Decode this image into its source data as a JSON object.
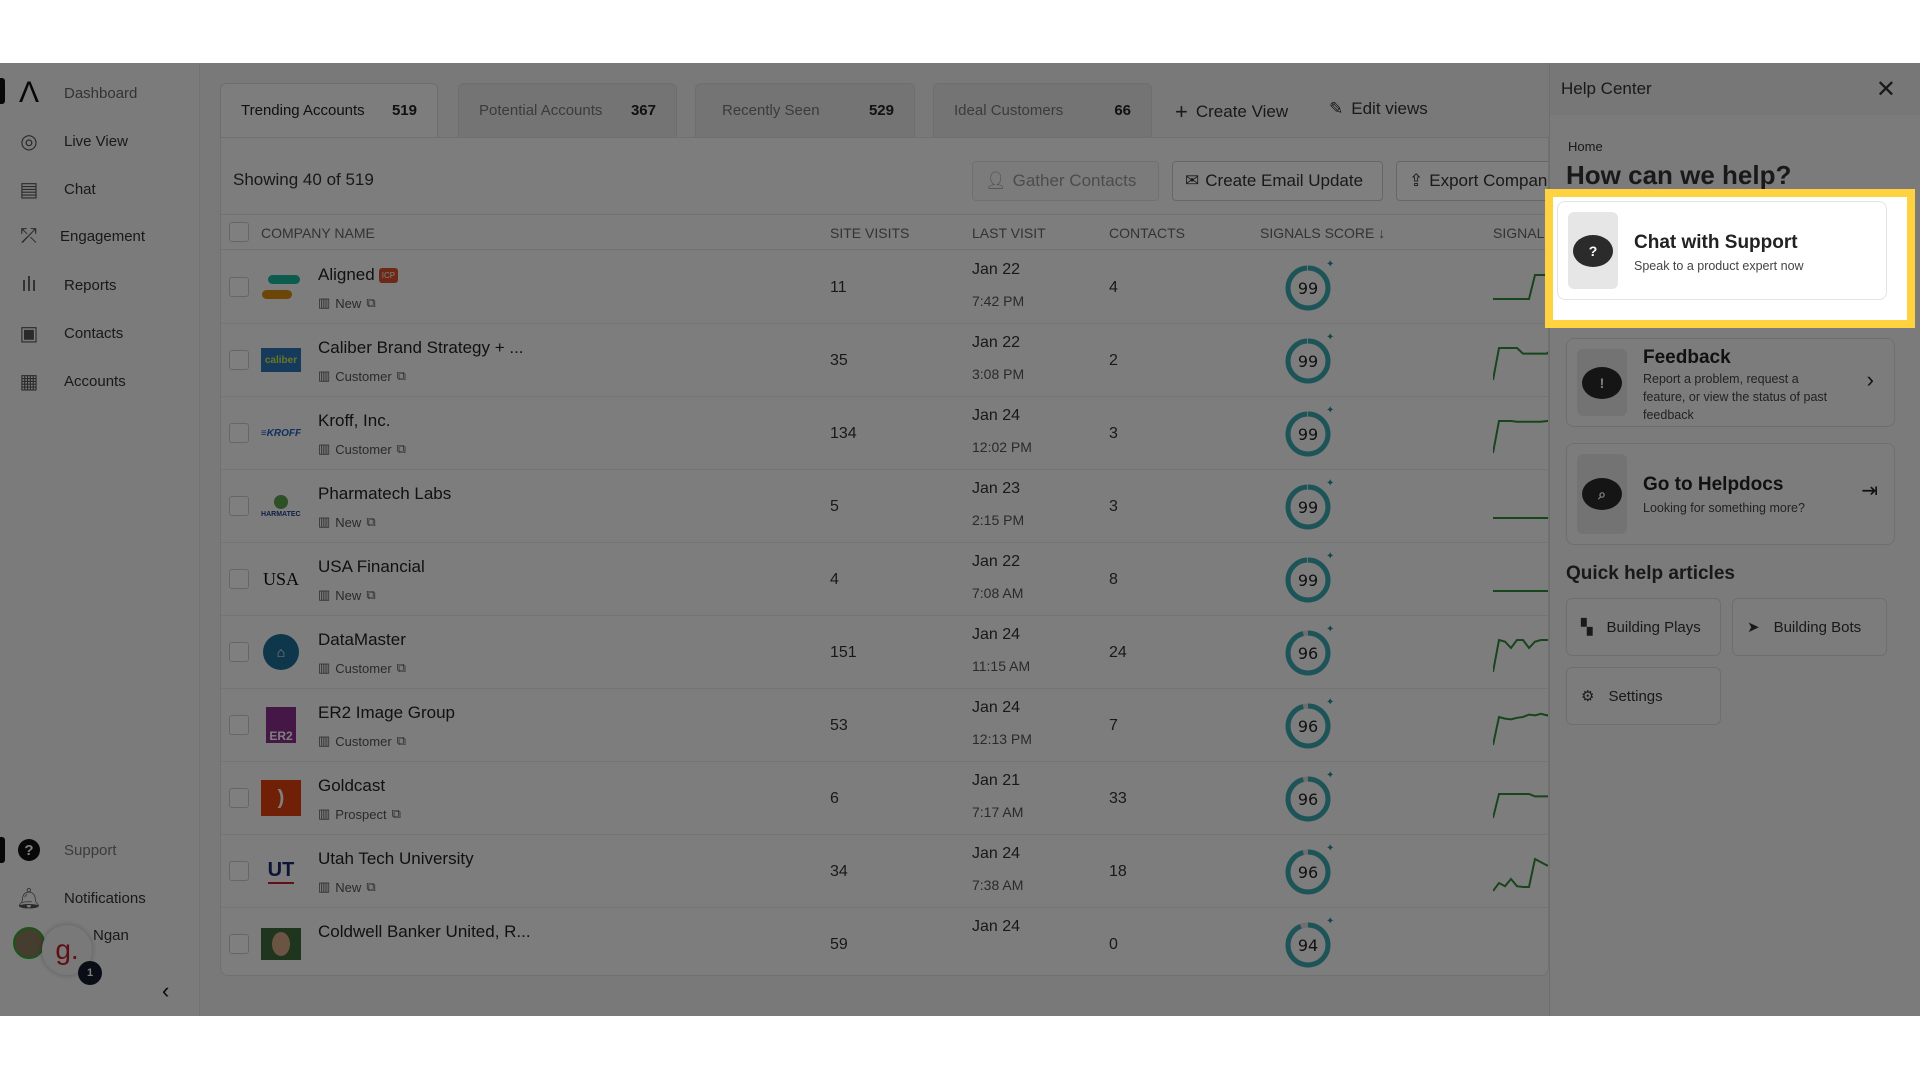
{
  "sidebar": {
    "items": [
      {
        "label": "Dashboard",
        "icon": "logo-icon"
      },
      {
        "label": "Live View",
        "icon": "globe-search-icon"
      },
      {
        "label": "Chat",
        "icon": "chat-icon"
      },
      {
        "label": "Engagement",
        "icon": "strategy-icon"
      },
      {
        "label": "Reports",
        "icon": "bar-chart-icon"
      },
      {
        "label": "Contacts",
        "icon": "contact-card-icon"
      },
      {
        "label": "Accounts",
        "icon": "building-icon"
      }
    ],
    "support": "Support",
    "notifications": "Notifications",
    "user": {
      "name": "Ngan",
      "badge": "1",
      "avatar_letter": "g."
    }
  },
  "tabs": [
    {
      "label": "Trending Accounts",
      "count": "519"
    },
    {
      "label": "Potential Accounts",
      "count": "367"
    },
    {
      "label": "Recently Seen",
      "count": "529"
    },
    {
      "label": "Ideal Customers",
      "count": "66"
    }
  ],
  "tab_actions": {
    "create_view": "Create View",
    "edit_views": "Edit views"
  },
  "toolbar": {
    "showing": "Showing 40 of  519",
    "gather": "Gather Contacts",
    "email": "Create Email Update",
    "export": "Export Compan"
  },
  "columns": [
    "COMPANY NAME",
    "SITE VISITS",
    "LAST VISIT",
    "CONTACTS",
    "SIGNALS SCORE ↓",
    "SIGNALS"
  ],
  "rows": [
    {
      "name": "Aligned",
      "icp": "ICP",
      "status": "New",
      "visits": "11",
      "date": "Jan 22",
      "time": "7:42 PM",
      "contacts": "4",
      "score": 99,
      "logo": "aligned",
      "trend": [
        1,
        1,
        1,
        1,
        1,
        1,
        1,
        4,
        4,
        4,
        4
      ]
    },
    {
      "name": "Caliber Brand Strategy + ...",
      "status": "Customer",
      "visits": "35",
      "date": "Jan 22",
      "time": "3:08 PM",
      "contacts": "2",
      "score": 99,
      "logo": "caliber",
      "trend": [
        0,
        4,
        4,
        4,
        4,
        3.3,
        3.3,
        3.3,
        3.3,
        3.3,
        4
      ]
    },
    {
      "name": "Kroff, Inc.",
      "status": "Customer",
      "visits": "134",
      "date": "Jan 24",
      "time": "12:02 PM",
      "contacts": "3",
      "score": 99,
      "logo": "kroff",
      "trend": [
        0,
        4,
        4,
        4,
        3.9,
        3.9,
        3.9,
        3.9,
        3.9,
        4,
        4
      ]
    },
    {
      "name": "Pharmatech Labs",
      "status": "New",
      "visits": "5",
      "date": "Jan 23",
      "time": "2:15 PM",
      "contacts": "3",
      "score": 99,
      "logo": "pharmatech",
      "trend": [
        1,
        1,
        1,
        1,
        1,
        1,
        1,
        1,
        1,
        1,
        1
      ]
    },
    {
      "name": "USA Financial",
      "status": "New",
      "visits": "4",
      "date": "Jan 22",
      "time": "7:08 AM",
      "contacts": "8",
      "score": 99,
      "logo": "usa",
      "trend": [
        1,
        1,
        1,
        1,
        1,
        1,
        1,
        1,
        1,
        1,
        1
      ]
    },
    {
      "name": "DataMaster",
      "status": "Customer",
      "visits": "151",
      "date": "Jan 24",
      "time": "11:15 AM",
      "contacts": "24",
      "score": 96,
      "logo": "datamaster",
      "trend": [
        0,
        4,
        3.8,
        3,
        4,
        4,
        3,
        3.8,
        4,
        4,
        4
      ]
    },
    {
      "name": "ER2 Image Group",
      "status": "Customer",
      "visits": "53",
      "date": "Jan 24",
      "time": "12:13 PM",
      "contacts": "7",
      "score": 96,
      "logo": "er2",
      "trend": [
        0,
        3.5,
        3.3,
        3.2,
        3.4,
        3.5,
        3.8,
        3.7,
        3.9,
        3.7,
        4
      ]
    },
    {
      "name": "Goldcast",
      "status": "Prospect",
      "visits": "6",
      "date": "Jan 21",
      "time": "7:17 AM",
      "contacts": "33",
      "score": 96,
      "logo": "goldcast",
      "trend": [
        0,
        3,
        3,
        3,
        3,
        3,
        3,
        2.7,
        2.7,
        2.7,
        2.8
      ]
    },
    {
      "name": "Utah Tech University",
      "status": "New",
      "visits": "34",
      "date": "Jan 24",
      "time": "7:38 AM",
      "contacts": "18",
      "score": 96,
      "logo": "utah",
      "trend": [
        0,
        1,
        0.6,
        1.5,
        0.6,
        0.5,
        0.5,
        4,
        3.6,
        3.2,
        3.1
      ]
    },
    {
      "name": "Coldwell Banker United, R...",
      "status": "",
      "visits": "59",
      "date": "Jan 24",
      "time": "",
      "contacts": "0",
      "score": 94,
      "logo": "coldwell",
      "trend": []
    }
  ],
  "help": {
    "title": "Help Center",
    "breadcrumb": "Home",
    "heading": "How can we help?",
    "cards": [
      {
        "title": "Chat with Support",
        "subtitle": "Speak to a product expert now"
      },
      {
        "title": "Feedback",
        "subtitle": "Report a problem, request a feature, or view the status of past feedback"
      },
      {
        "title": "Go to Helpdocs",
        "subtitle": "Looking for something more?"
      }
    ],
    "quick_title": "Quick help articles",
    "quick": [
      "Building Plays",
      "Building Bots",
      "Settings"
    ]
  },
  "colors": {
    "score_ring": "#3aa9b1",
    "trend": "#2f8a3a",
    "highlight": "#ffd23f",
    "overlay": "rgba(0,0,0,0.5)"
  }
}
